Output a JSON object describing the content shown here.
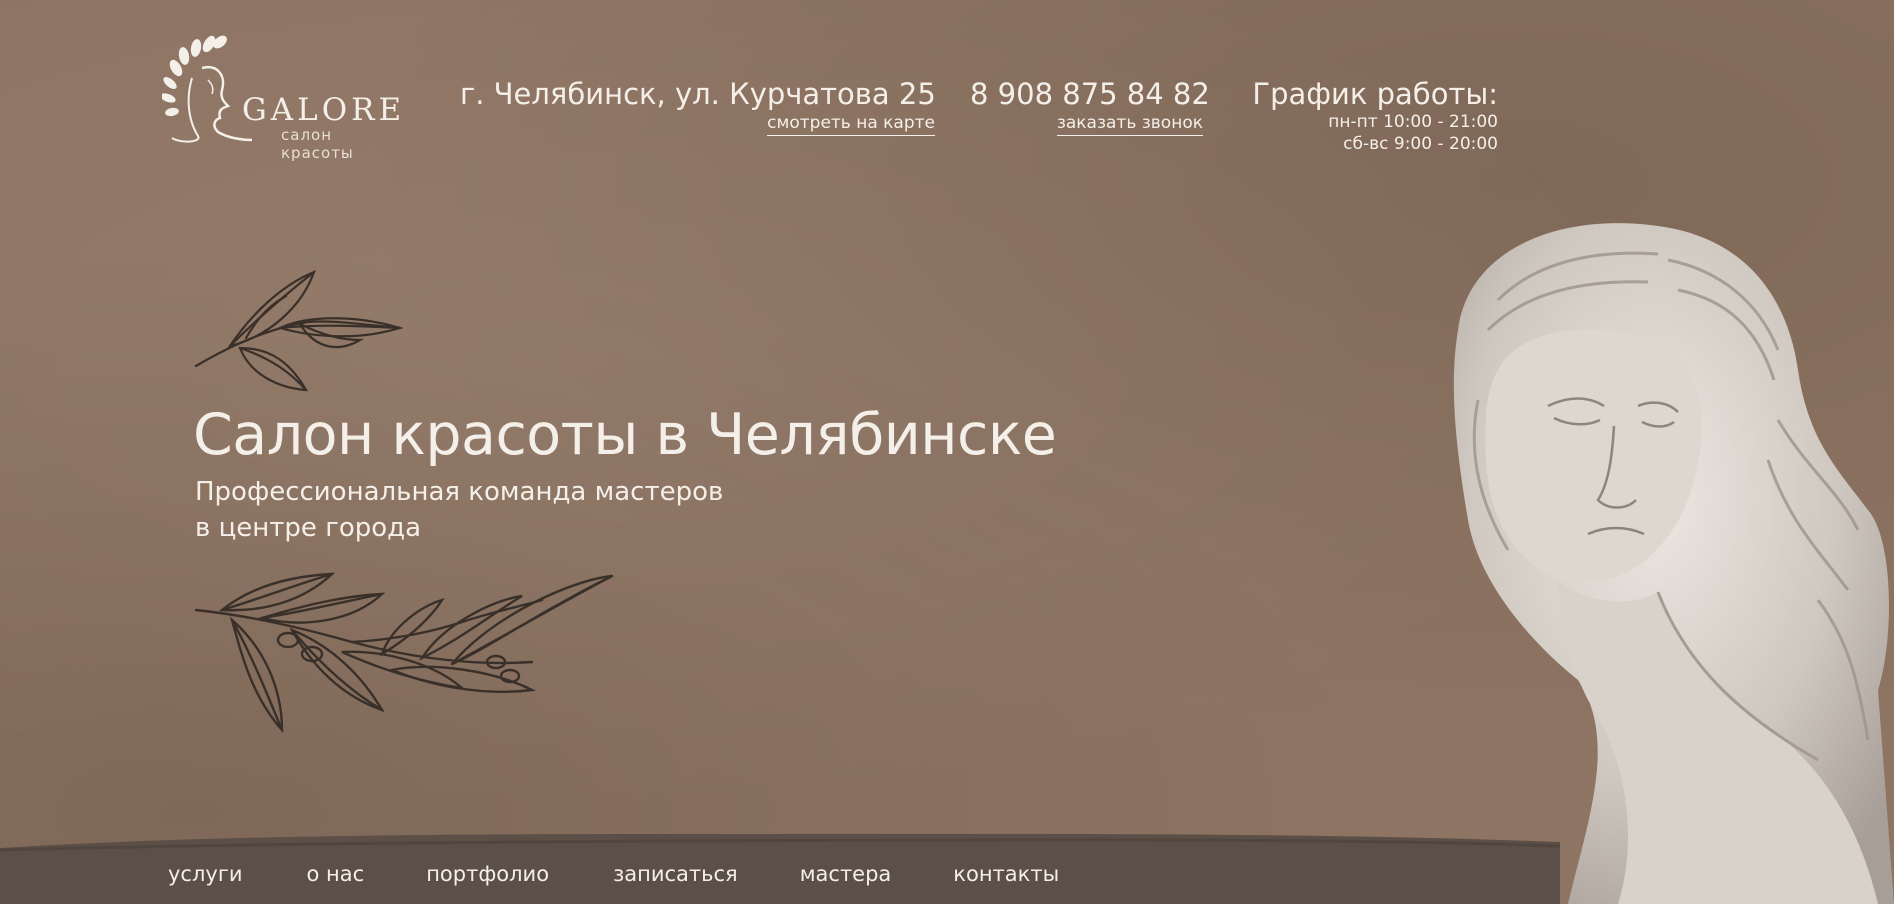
{
  "brand": {
    "name": "GALORE",
    "subtitle": "салон красоты"
  },
  "header": {
    "address": "г. Челябинск, ул. Курчатова 25",
    "map_link": "смотреть на карте",
    "phone": "8 908 875 84 82",
    "callback_link": "заказать звонок",
    "schedule_title": "График работы:",
    "schedule_weekdays": "пн-пт 10:00 - 21:00",
    "schedule_weekend": "сб-вс 9:00 - 20:00"
  },
  "hero": {
    "title": "Салон красоты в Челябинске",
    "subtitle_line1": "Профессиональная команда мастеров",
    "subtitle_line2": "в центре города"
  },
  "nav": {
    "items": [
      "услуги",
      "о нас",
      "портфолио",
      "записаться",
      "мастера",
      "контакты"
    ]
  },
  "colors": {
    "background": "#8e7462",
    "text": "#f4efe8",
    "strip": "#5b4f47",
    "branch": "#3a302a",
    "statue": "#dcd6cf"
  },
  "icons": {
    "logo": "laurel-head-logo",
    "decor_top": "olive-branch-small",
    "decor_bottom": "olive-branch-large",
    "hero_image": "marble-statue"
  }
}
